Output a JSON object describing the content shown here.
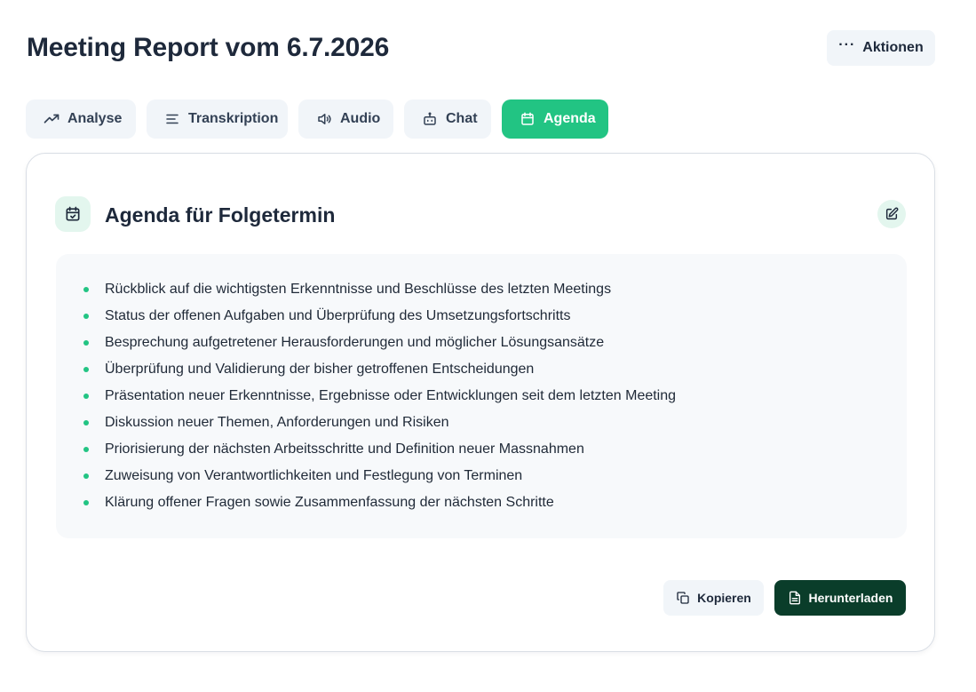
{
  "header": {
    "title": "Meeting Report vom 6.7.2026",
    "actions_icon": "more-horizontal-icon",
    "actions_label": "Aktionen"
  },
  "tabs": [
    {
      "label": "Analyse",
      "icon": "trending-up-icon",
      "active": false
    },
    {
      "label": "Transkription",
      "icon": "text-lines-icon",
      "active": false
    },
    {
      "label": "Audio",
      "icon": "speaker-icon",
      "active": false
    },
    {
      "label": "Chat",
      "icon": "bot-icon",
      "active": false
    },
    {
      "label": "Agenda",
      "icon": "calendar-icon",
      "active": true
    }
  ],
  "card": {
    "icon": "calendar-check-icon",
    "title": "Agenda für Folgetermin",
    "edit_icon": "edit-icon",
    "items": [
      "Rückblick auf die wichtigsten Erkenntnisse und Beschlüsse des letzten Meetings",
      "Status der offenen Aufgaben und Überprüfung des Umsetzungsfortschritts",
      "Besprechung aufgetretener Herausforderungen und möglicher Lösungsansätze",
      "Überprüfung und Validierung der bisher getroffenen Entscheidungen",
      "Präsentation neuer Erkenntnisse, Ergebnisse oder Entwicklungen seit dem letzten Meeting",
      "Diskussion neuer Themen, Anforderungen und Risiken",
      "Priorisierung der nächsten Arbeitsschritte und Definition neuer Massnahmen",
      "Zuweisung von Verantwortlichkeiten und Festlegung von Terminen",
      "Klärung offener Fragen sowie Zusammenfassung der nächsten Schritte"
    ],
    "copy_label": "Kopieren",
    "download_label": "Herunterladen"
  },
  "colors": {
    "accent": "#22c483",
    "accent_soft": "#e3f6ee",
    "dark_button": "#0a3d2a",
    "tab_bg": "#f1f5f9"
  }
}
